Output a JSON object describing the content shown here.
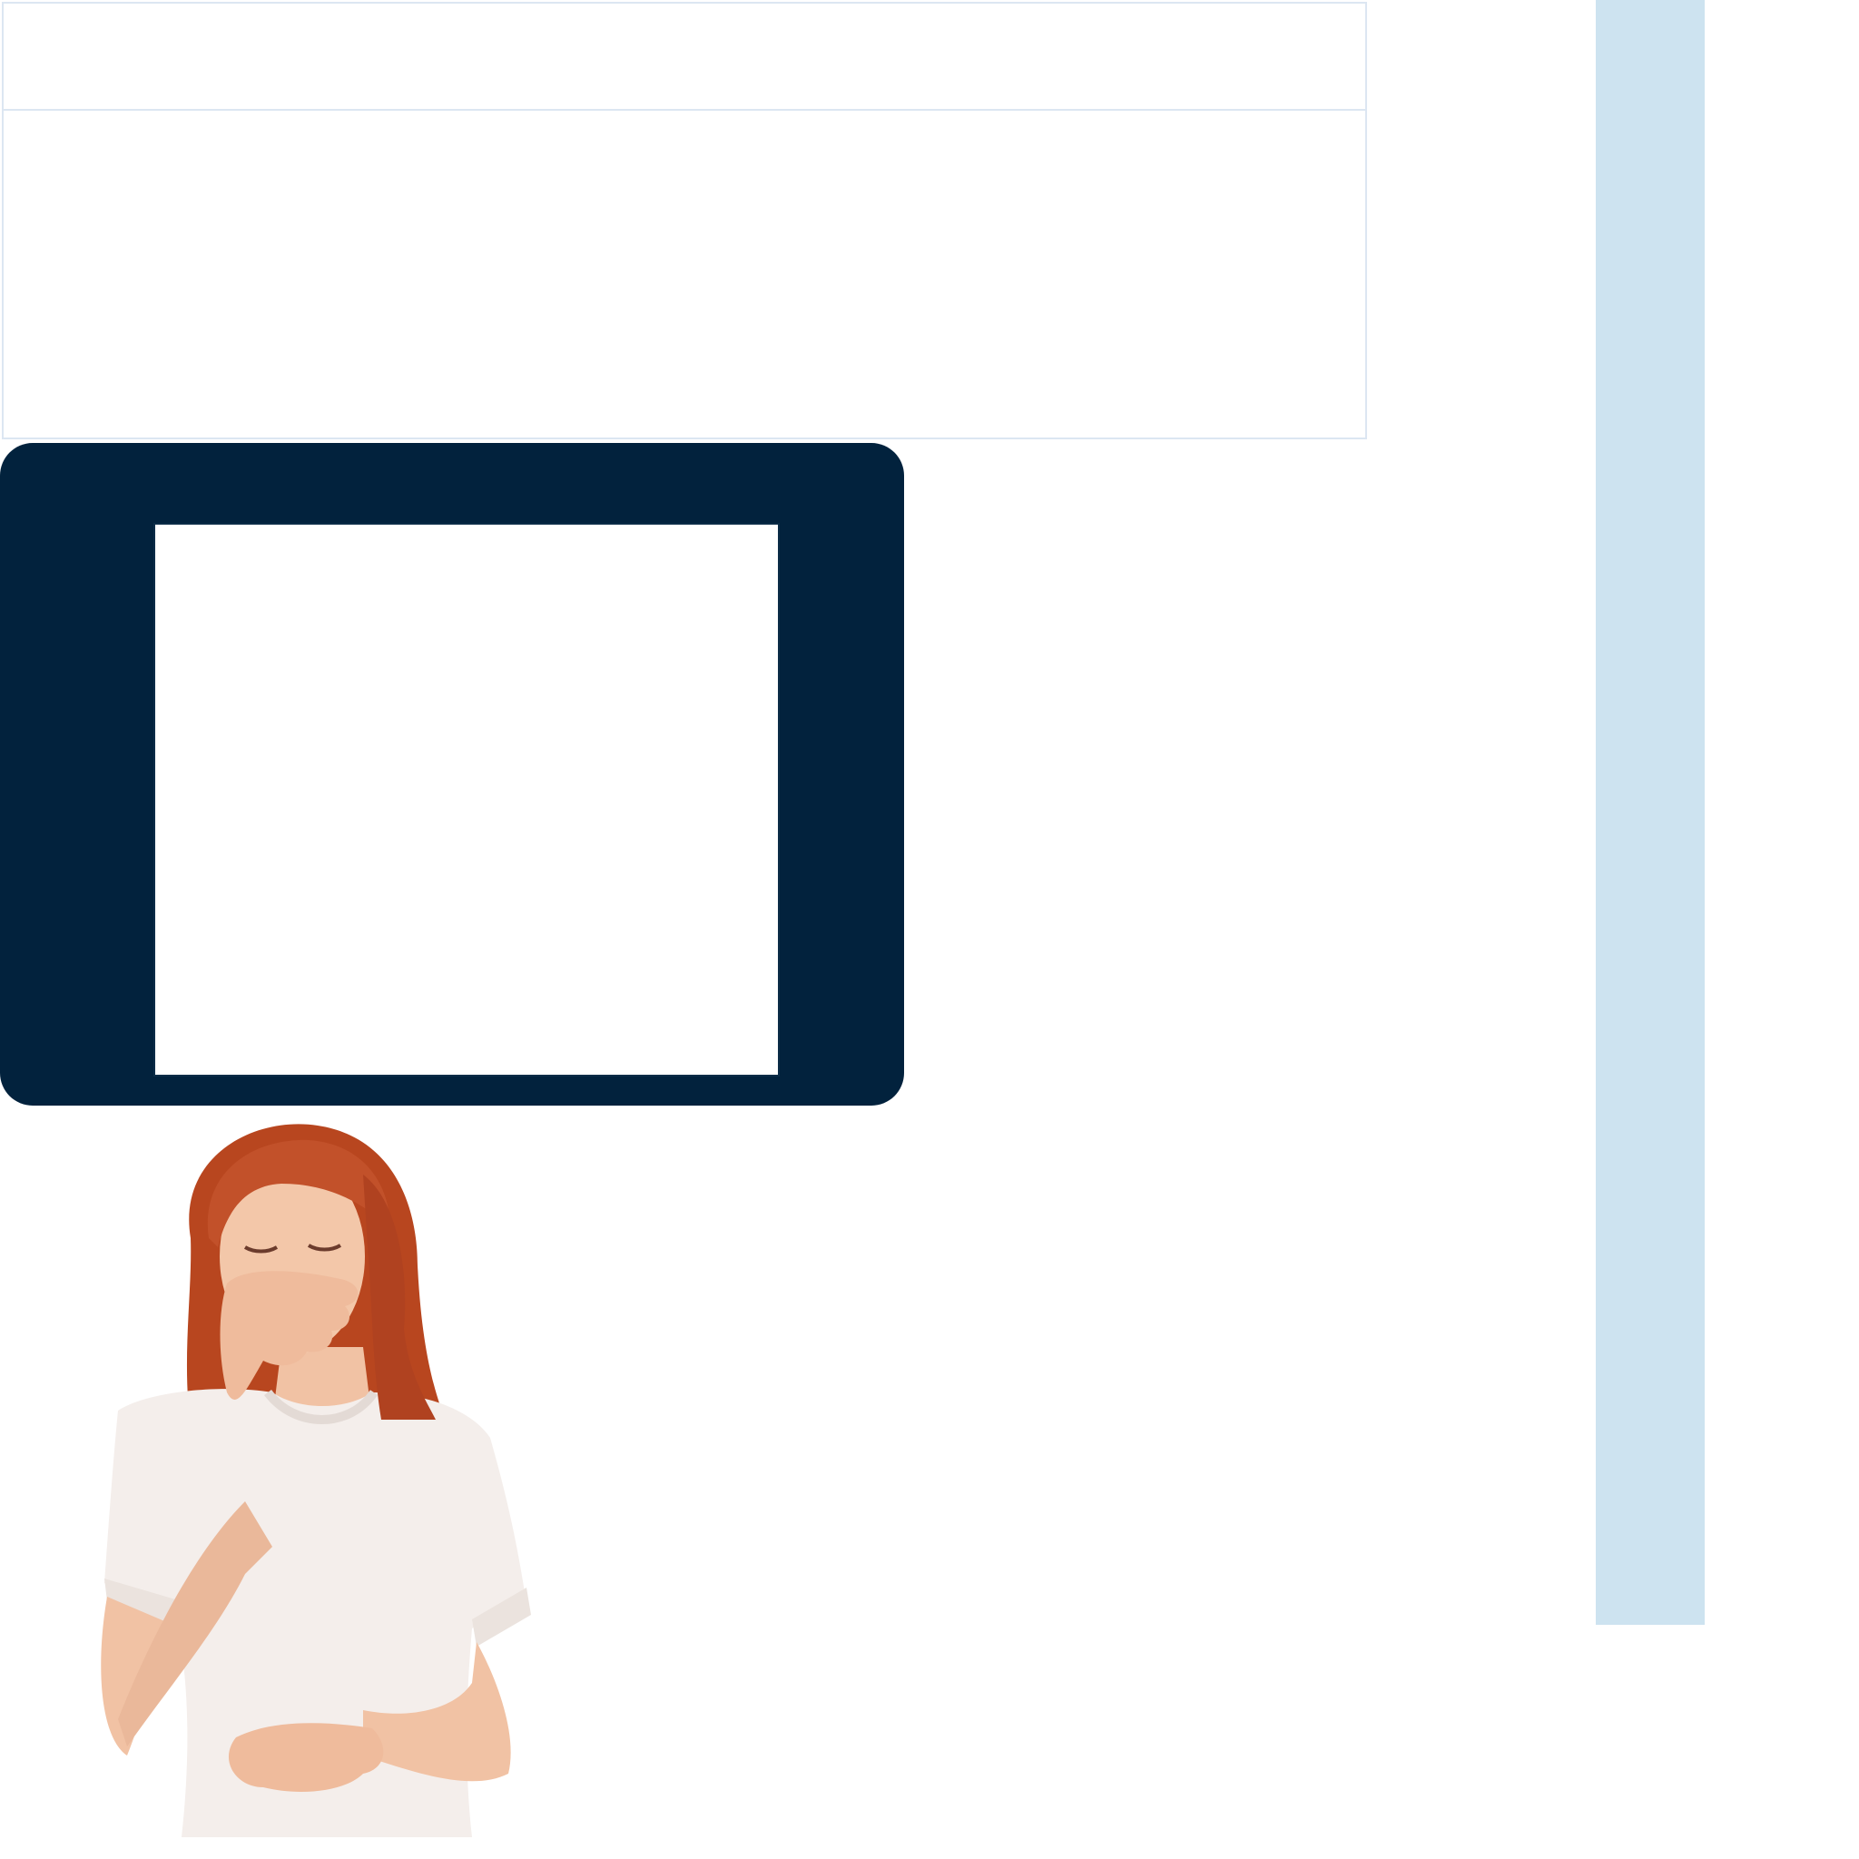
{
  "colors": {
    "panel_border": "#dce6f2",
    "dark_card": "#02223d",
    "side_bar": "#cde3f0",
    "background": "#ffffff"
  },
  "photo": {
    "subject": "woman-holding-mouth-and-stomach"
  }
}
